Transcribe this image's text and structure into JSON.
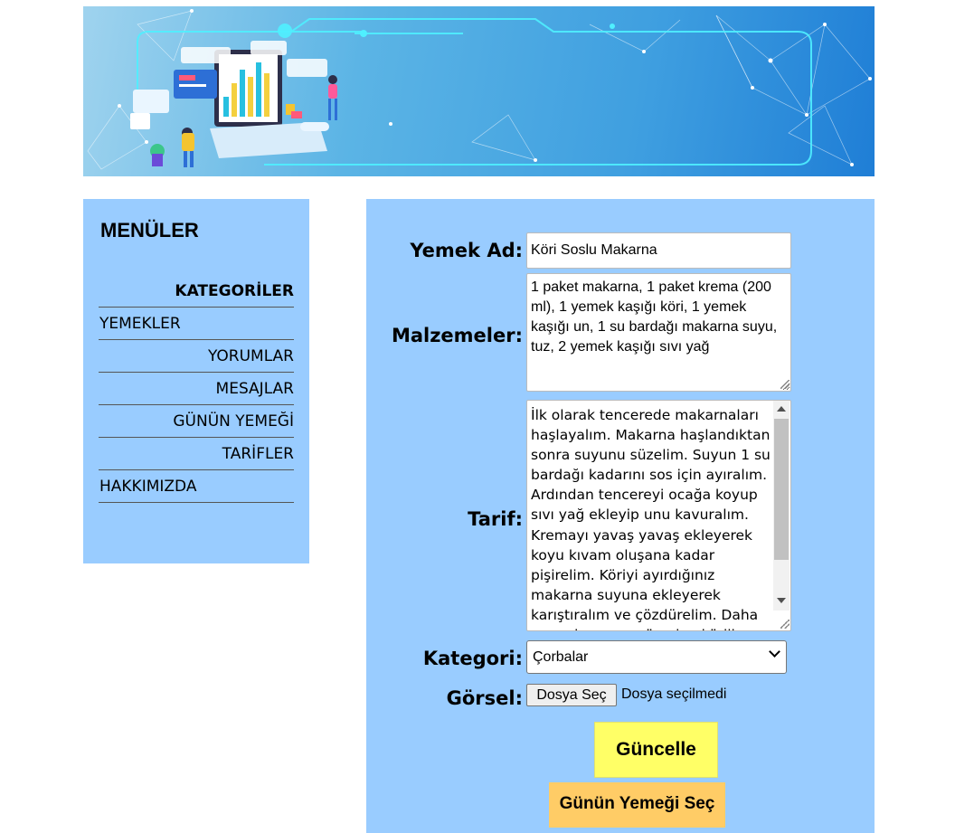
{
  "menu": {
    "title": "MENÜLER",
    "items": [
      {
        "label": "KATEGORİLER"
      },
      {
        "label": "YEMEKLER"
      },
      {
        "label": "YORUMLAR"
      },
      {
        "label": "MESAJLAR"
      },
      {
        "label": "GÜNÜN YEMEĞİ"
      },
      {
        "label": "TARİFLER"
      },
      {
        "label": "HAKKIMIZDA"
      }
    ]
  },
  "form": {
    "name_label": "Yemek Ad:",
    "name_value": "Köri Soslu Makarna",
    "ingredients_label": "Malzemeler:",
    "ingredients_value": "1 paket makarna, 1 paket krema (200 ml), 1 yemek kaşığı köri, 1 yemek kaşığı un, 1 su bardağı makarna suyu, tuz, 2 yemek kaşığı sıvı yağ",
    "recipe_label": "Tarif:",
    "recipe_value": "İlk olarak tencerede makarnaları haşlayalım. Makarna haşlandıktan sonra suyunu süzelim. Suyun 1 su bardağı kadarını sos için ayıralım. Ardından tencereyi ocağa koyup sıvı yağ ekleyip unu kavuralım. Kremayı yavaş yavaş ekleyerek koyu kıvam oluşana kadar pişirelim. Köriyi ayırdığınız makarna suyuna ekleyerek karıştıralım ve çözdürelim. Daha sonra kremanın üzerine körili suyu ekleyelim. Son olarak tuz ve",
    "category_label": "Kategori:",
    "category_value": "Çorbalar",
    "image_label": "Görsel:",
    "file_button": "Dosya Seç",
    "file_status": "Dosya seçilmedi",
    "update_button": "Güncelle",
    "daily_button": "Günün Yemeği Seç"
  },
  "colors": {
    "panel_bg": "#99ccff",
    "update_btn": "#ffff66",
    "daily_btn": "#ffcc66"
  }
}
